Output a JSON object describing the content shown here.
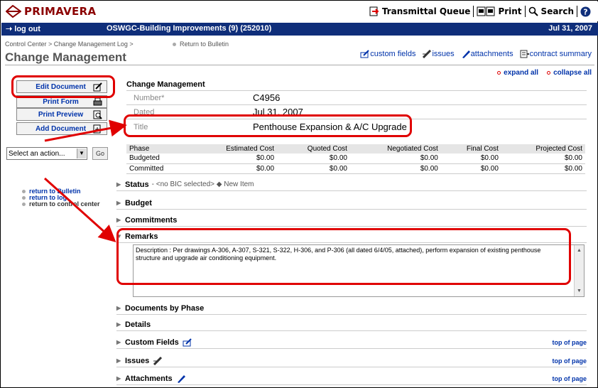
{
  "brand": {
    "name": "PRIMAVERA"
  },
  "top_actions": [
    {
      "label": "Transmittal Queue",
      "icon": "transmittal-icon"
    },
    {
      "label": "Print",
      "icon": "print-icon"
    },
    {
      "label": "Search",
      "icon": "search-icon"
    }
  ],
  "header": {
    "logout": "log out",
    "project": "OSWGC-Building Improvements (9) (252010)",
    "date": "Jul 31, 2007"
  },
  "breadcrumb": "Control Center > Change Management Log >",
  "return_to_bulletin_top": "Return to Bulletin",
  "page_title": "Change Management",
  "subnav": {
    "custom_fields": "custom fields",
    "issues": "issues",
    "attachments": "attachments",
    "contract_summary": "contract summary"
  },
  "sidebar": {
    "buttons": [
      "Edit Document",
      "Print Form",
      "Print Preview",
      "Add Document"
    ],
    "select_action": "Select an action...",
    "go": "Go",
    "links": [
      "return to Bulletin",
      "return to log",
      "return to control center"
    ]
  },
  "expand": {
    "expand_all": "expand all",
    "collapse_all": "collapse all"
  },
  "form": {
    "heading": "Change Management",
    "number_label": "Number*",
    "number_value": "C4956",
    "dated_label": "Dated",
    "dated_value": "Jul 31, 2007",
    "title_label": "Title",
    "title_value": "Penthouse Expansion & A/C Upgrade"
  },
  "cost_table": {
    "headers": [
      "Phase",
      "Estimated Cost",
      "Quoted Cost",
      "Negotiated Cost",
      "Final Cost",
      "Projected Cost"
    ],
    "rows": [
      [
        "Budgeted",
        "$0.00",
        "$0.00",
        "$0.00",
        "$0.00",
        "$0.00"
      ],
      [
        "Committed",
        "$0.00",
        "$0.00",
        "$0.00",
        "$0.00",
        "$0.00"
      ]
    ]
  },
  "sections": {
    "status": "Status",
    "status_detail": "- <no BIC selected> ◆ New Item",
    "budget": "Budget",
    "commitments": "Commitments",
    "remarks": "Remarks",
    "remarks_text": "Description : Per drawings A-306, A-307, S-321, S-322, H-306, and P-306 (all dated 6/4/05, attached), perform expansion of existing penthouse structure and upgrade air conditioning equipment.",
    "documents_by_phase": "Documents by Phase",
    "details": "Details",
    "custom_fields": "Custom Fields",
    "issues": "Issues",
    "attachments": "Attachments",
    "top_of_page": "top of page"
  },
  "colors": {
    "brand": "#8b0000",
    "header_bg": "#0f2e7a",
    "link": "#0033aa",
    "annotation": "#e00000"
  }
}
